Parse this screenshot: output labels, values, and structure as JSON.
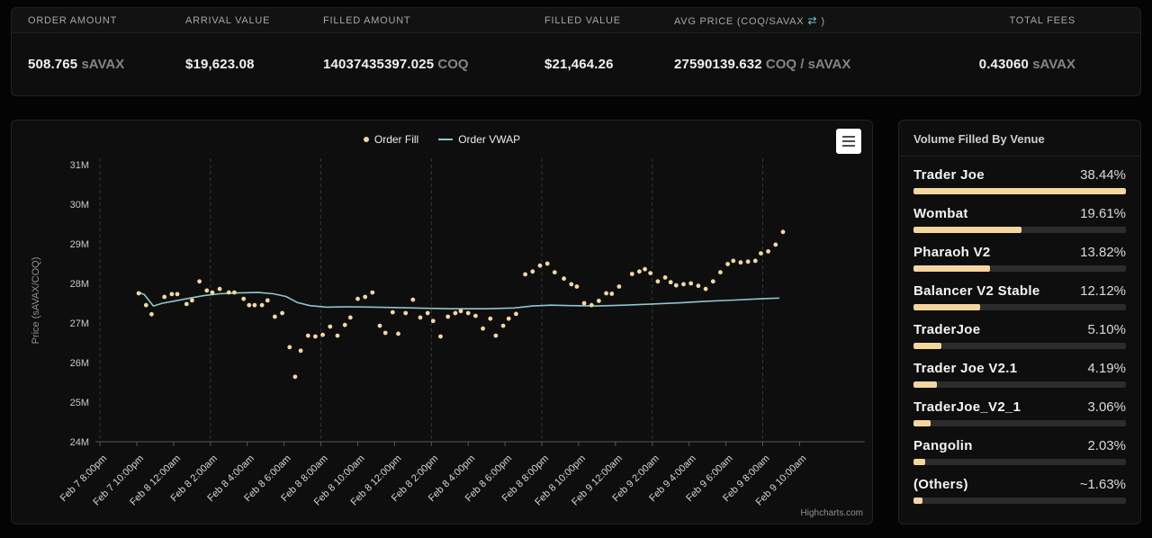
{
  "colors": {
    "scatter": "#f2d7a4",
    "vwap": "#8fc6cb",
    "bar_fill": "#f6d69e",
    "bar_track": "#2c2c2c",
    "swap_icon": "#6fc7ce",
    "grid": "rgba(255,255,255,0.16)",
    "axis": "#555555"
  },
  "stats": {
    "columns": [
      {
        "key": "order-amount",
        "label": "ORDER AMOUNT",
        "value": "508.765",
        "unit": "sAVAX"
      },
      {
        "key": "arrival-value",
        "label": "ARRIVAL VALUE",
        "value": "$19,623.08",
        "unit": ""
      },
      {
        "key": "filled-amount",
        "label": "FILLED AMOUNT",
        "value": "14037435397.025",
        "unit": "COQ"
      },
      {
        "key": "filled-value",
        "label": "FILLED VALUE",
        "value": "$21,464.26",
        "unit": ""
      },
      {
        "key": "avg-price",
        "label": "AVG PRICE (COQ/SAVAX",
        "icon": "⇄",
        "label_close": ")",
        "value": "27590139.632",
        "unit": "COQ / sAVAX"
      },
      {
        "key": "total-fees",
        "label": "TOTAL FEES",
        "value": "0.43060",
        "unit": "sAVAX"
      }
    ]
  },
  "legend": {
    "items": [
      {
        "label": "Order Fill",
        "marker": "dot"
      },
      {
        "label": "Order VWAP",
        "marker": "line"
      }
    ]
  },
  "chart_data": {
    "type": "scatter",
    "title": "",
    "ylabel": "Price (sAVAX/COQ)",
    "ylim": [
      24,
      31.16
    ],
    "xlim": [
      -0.25,
      41.55
    ],
    "grid": "vertical-dashed",
    "legend_position": "top-center",
    "ytick_values": [
      24,
      25,
      26,
      27,
      28,
      29,
      30,
      31
    ],
    "ytick_labels": [
      "24M",
      "25M",
      "26M",
      "27M",
      "28M",
      "29M",
      "30M",
      "31M"
    ],
    "xtick_hours": [
      0,
      2,
      4,
      6,
      8,
      10,
      12,
      14,
      16,
      18,
      20,
      22,
      24,
      26,
      28,
      30,
      32,
      34,
      36,
      38
    ],
    "xtick_labels": [
      "Feb 7 8:00pm",
      "Feb 7 10:00pm",
      "Feb 8 12:00am",
      "Feb 8 2:00am",
      "Feb 8 4:00am",
      "Feb 8 6:00am",
      "Feb 8 8:00am",
      "Feb 8 10:00am",
      "Feb 8 12:00pm",
      "Feb 8 2:00pm",
      "Feb 8 4:00pm",
      "Feb 8 6:00pm",
      "Feb 8 8:00pm",
      "Feb 8 10:00pm",
      "Feb 9 12:00am",
      "Feb 9 2:00am",
      "Feb 9 4:00am",
      "Feb 9 6:00am",
      "Feb 9 8:00am",
      "Feb 9 10:00am"
    ],
    "gridline_hours": [
      0,
      6,
      12,
      18,
      24,
      30,
      36
    ],
    "series": [
      {
        "name": "Order Fill",
        "type": "scatter",
        "color": "#f2d7a4",
        "points": [
          [
            2.1,
            27.75
          ],
          [
            2.5,
            27.45
          ],
          [
            2.8,
            27.22
          ],
          [
            3.5,
            27.66
          ],
          [
            3.9,
            27.73
          ],
          [
            4.2,
            27.73
          ],
          [
            4.7,
            27.48
          ],
          [
            5.0,
            27.57
          ],
          [
            5.4,
            28.05
          ],
          [
            5.8,
            27.82
          ],
          [
            6.1,
            27.77
          ],
          [
            6.5,
            27.86
          ],
          [
            7.0,
            27.77
          ],
          [
            7.3,
            27.77
          ],
          [
            7.8,
            27.61
          ],
          [
            8.1,
            27.45
          ],
          [
            8.4,
            27.45
          ],
          [
            8.8,
            27.45
          ],
          [
            9.1,
            27.57
          ],
          [
            9.5,
            27.16
          ],
          [
            9.9,
            27.25
          ],
          [
            10.3,
            26.39
          ],
          [
            10.6,
            25.64
          ],
          [
            10.9,
            26.3
          ],
          [
            11.3,
            26.68
          ],
          [
            11.7,
            26.66
          ],
          [
            12.1,
            26.7
          ],
          [
            12.5,
            26.91
          ],
          [
            12.9,
            26.68
          ],
          [
            13.3,
            26.95
          ],
          [
            13.6,
            27.14
          ],
          [
            14.0,
            27.61
          ],
          [
            14.4,
            27.66
          ],
          [
            14.8,
            27.77
          ],
          [
            15.2,
            26.93
          ],
          [
            15.5,
            26.75
          ],
          [
            15.9,
            27.27
          ],
          [
            16.2,
            26.73
          ],
          [
            16.6,
            27.25
          ],
          [
            17.0,
            27.59
          ],
          [
            17.4,
            27.14
          ],
          [
            17.8,
            27.25
          ],
          [
            18.1,
            27.05
          ],
          [
            18.5,
            26.66
          ],
          [
            18.9,
            27.16
          ],
          [
            19.3,
            27.25
          ],
          [
            19.6,
            27.3
          ],
          [
            20.0,
            27.25
          ],
          [
            20.4,
            27.18
          ],
          [
            20.8,
            26.86
          ],
          [
            21.2,
            27.11
          ],
          [
            21.5,
            26.68
          ],
          [
            21.9,
            26.93
          ],
          [
            22.2,
            27.11
          ],
          [
            22.6,
            27.23
          ],
          [
            23.1,
            28.23
          ],
          [
            23.5,
            28.3
          ],
          [
            23.9,
            28.45
          ],
          [
            24.3,
            28.5
          ],
          [
            24.7,
            28.28
          ],
          [
            25.2,
            28.12
          ],
          [
            25.6,
            27.98
          ],
          [
            25.9,
            27.92
          ],
          [
            26.3,
            27.5
          ],
          [
            26.7,
            27.45
          ],
          [
            27.1,
            27.56
          ],
          [
            27.5,
            27.75
          ],
          [
            27.8,
            27.74
          ],
          [
            28.2,
            27.92
          ],
          [
            28.9,
            28.24
          ],
          [
            29.3,
            28.3
          ],
          [
            29.6,
            28.36
          ],
          [
            29.9,
            28.26
          ],
          [
            30.3,
            28.05
          ],
          [
            30.7,
            28.15
          ],
          [
            31.0,
            28.03
          ],
          [
            31.3,
            27.95
          ],
          [
            31.7,
            27.98
          ],
          [
            32.1,
            28.0
          ],
          [
            32.5,
            27.94
          ],
          [
            32.9,
            27.86
          ],
          [
            33.3,
            28.05
          ],
          [
            33.7,
            28.28
          ],
          [
            34.1,
            28.49
          ],
          [
            34.4,
            28.57
          ],
          [
            34.8,
            28.53
          ],
          [
            35.2,
            28.55
          ],
          [
            35.6,
            28.57
          ],
          [
            35.9,
            28.76
          ],
          [
            36.3,
            28.81
          ],
          [
            36.7,
            28.98
          ],
          [
            37.1,
            29.3
          ]
        ]
      },
      {
        "name": "Order VWAP",
        "type": "line",
        "color": "#8fc6cb",
        "points": [
          [
            2.1,
            27.77
          ],
          [
            2.4,
            27.72
          ],
          [
            2.9,
            27.43
          ],
          [
            3.4,
            27.5
          ],
          [
            4.0,
            27.55
          ],
          [
            4.8,
            27.62
          ],
          [
            5.6,
            27.69
          ],
          [
            6.5,
            27.74
          ],
          [
            7.5,
            27.76
          ],
          [
            8.6,
            27.77
          ],
          [
            9.4,
            27.74
          ],
          [
            10.1,
            27.67
          ],
          [
            10.7,
            27.52
          ],
          [
            11.4,
            27.44
          ],
          [
            12.3,
            27.4
          ],
          [
            13.5,
            27.41
          ],
          [
            15.0,
            27.4
          ],
          [
            17.0,
            27.38
          ],
          [
            19.0,
            27.36
          ],
          [
            21.0,
            27.36
          ],
          [
            22.5,
            27.38
          ],
          [
            23.5,
            27.43
          ],
          [
            24.5,
            27.45
          ],
          [
            25.5,
            27.44
          ],
          [
            27.0,
            27.43
          ],
          [
            28.5,
            27.45
          ],
          [
            30.0,
            27.48
          ],
          [
            31.5,
            27.51
          ],
          [
            33.0,
            27.55
          ],
          [
            34.5,
            27.58
          ],
          [
            35.8,
            27.61
          ],
          [
            36.9,
            27.63
          ]
        ]
      }
    ],
    "credits": "Highcharts.com"
  },
  "venue": {
    "title": "Volume Filled By Venue",
    "items": [
      {
        "name": "Trader Joe",
        "pct": "38.44%",
        "bar": 100
      },
      {
        "name": "Wombat",
        "pct": "19.61%",
        "bar": 51.0
      },
      {
        "name": "Pharaoh V2",
        "pct": "13.82%",
        "bar": 35.9
      },
      {
        "name": "Balancer V2 Stable",
        "pct": "12.12%",
        "bar": 31.5
      },
      {
        "name": "TraderJoe",
        "pct": "5.10%",
        "bar": 13.3
      },
      {
        "name": "Trader Joe V2.1",
        "pct": "4.19%",
        "bar": 10.9
      },
      {
        "name": "TraderJoe_V2_1",
        "pct": "3.06%",
        "bar": 8.0
      },
      {
        "name": "Pangolin",
        "pct": "2.03%",
        "bar": 5.3
      },
      {
        "name": "(Others)",
        "pct": "~1.63%",
        "bar": 4.2
      }
    ]
  }
}
